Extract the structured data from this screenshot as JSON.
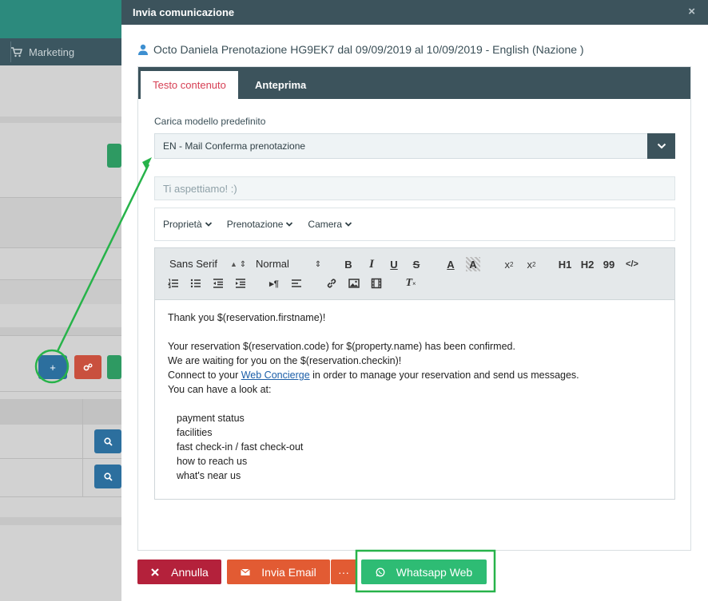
{
  "background": {
    "nav_item": "Marketing"
  },
  "modal": {
    "title": "Invia comunicazione",
    "close_symbol": "×",
    "guest_line": "Octo Daniela Prenotazione HG9EK7 dal 09/09/2019 al 10/09/2019 - English (Nazione )",
    "tabs": [
      {
        "label": "Testo contenuto",
        "active": true
      },
      {
        "label": "Anteprima",
        "active": false
      }
    ],
    "template": {
      "label": "Carica modello predefinito",
      "selected": "EN - Mail Conferma prenotazione"
    },
    "subject": {
      "placeholder": "Ti aspettiamo! :)"
    },
    "placeholders": [
      "Proprietà",
      "Prenotazione",
      "Camera"
    ],
    "toolbar": {
      "font": "Sans Serif",
      "size": "Normal",
      "bold": "B",
      "italic": "I",
      "underline": "U",
      "strike": "S",
      "color": "A",
      "background": "A",
      "subscript_base": "x",
      "subscript_mark": "2",
      "superscript_base": "x",
      "superscript_mark": "2",
      "h1": "H1",
      "h2": "H2",
      "quote": "99",
      "code": "</>"
    },
    "editor": {
      "greeting": "Thank you $(reservation.firstname)!",
      "line1": "Your reservation $(reservation.code) for $(property.name) has been confirmed.",
      "line2": "We are waiting for you on the $(reservation.checkin)!",
      "line3_prefix": "Connect to your ",
      "line3_link": "Web Concierge",
      "line3_suffix": " in order to manage your reservation and send us messages.",
      "line4": "You can have a look at:",
      "items": [
        "payment status",
        "facilities",
        "fast check-in / fast check-out",
        "how to reach us",
        "what's near us"
      ]
    },
    "buttons": {
      "cancel": "Annulla",
      "email": "Invia Email",
      "more": "···",
      "whatsapp": "Whatsapp Web"
    }
  },
  "colors": {
    "header": "#3c535c",
    "accent_tab": "#d63e53",
    "cancel": "#b4213b",
    "email": "#e25b33",
    "whatsapp": "#2ebc74",
    "annotation": "#27b34a"
  }
}
